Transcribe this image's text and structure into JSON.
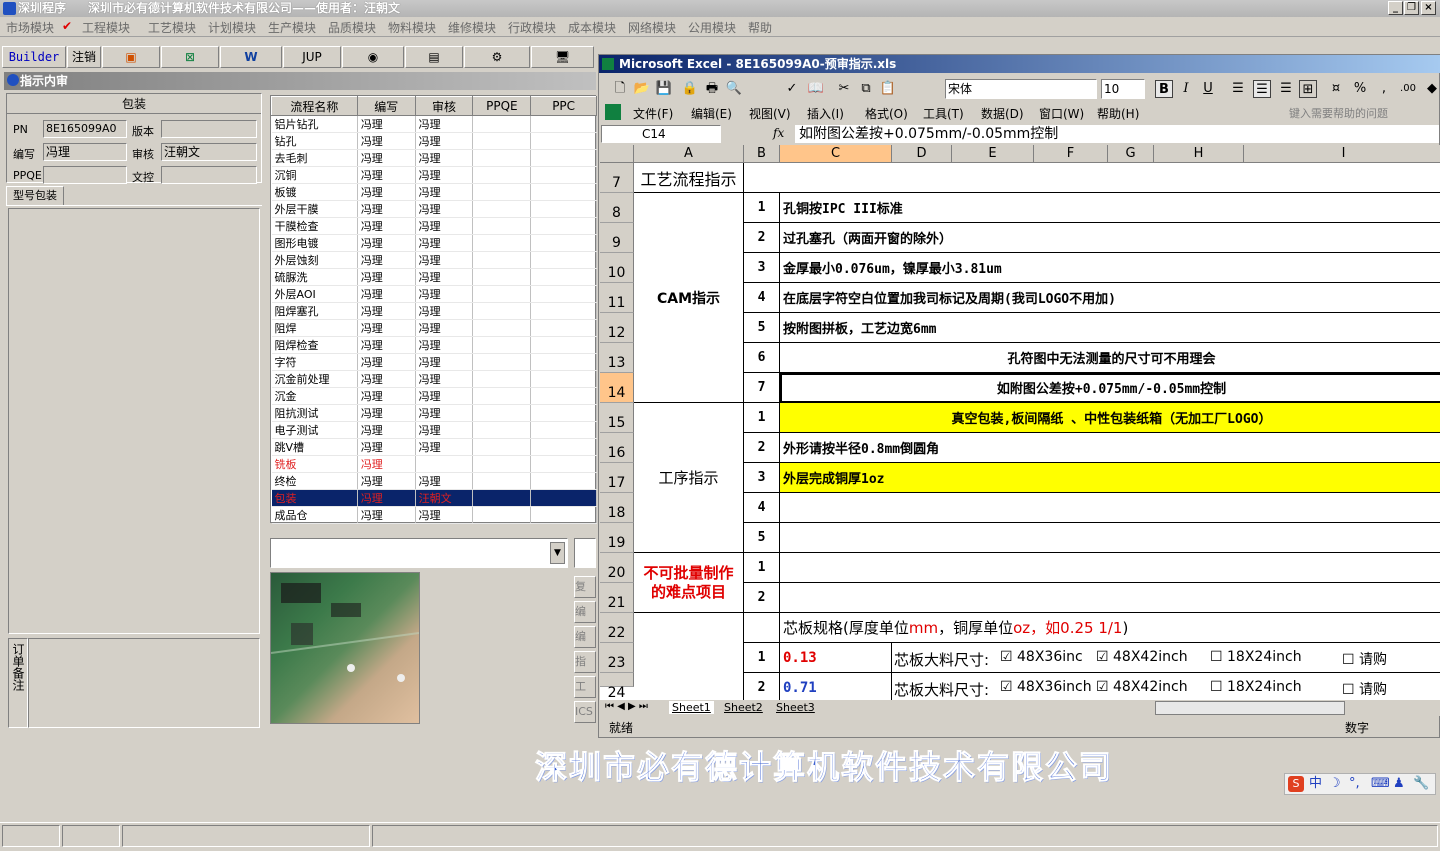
{
  "app": {
    "title": "深圳程序",
    "subtitle": "深圳市必有德计算机软件技术有限公司——使用者：汪朝文"
  },
  "menu": [
    "市场模块",
    "工程模块",
    "工艺模块",
    "计划模块",
    "生产模块",
    "品质模块",
    "物料模块",
    "维修模块",
    "行政模块",
    "成本模块",
    "网络模块",
    "公用模块",
    "帮助"
  ],
  "toolbar": {
    "builder": "Builder",
    "logout": "注销",
    "jup": "JUP"
  },
  "panel": {
    "title": "指示内审",
    "group": "包装",
    "pn_label": "PN",
    "pn_value": "8E165099A0",
    "version_label": "版本",
    "version_value": "",
    "writer_label": "编写",
    "writer_value": "冯理",
    "reviewer_label": "审核",
    "reviewer_value": "汪朝文",
    "ppqe_label": "PPQE",
    "ppqe_value": "",
    "doc_label": "文控",
    "doc_value": "",
    "tab": "型号包装",
    "order_note": "订单备注"
  },
  "process": {
    "headers": [
      "流程名称",
      "编写",
      "审核",
      "PPQE",
      "PPC"
    ],
    "rows": [
      [
        "铝片钻孔",
        "冯理",
        "冯理"
      ],
      [
        "钻孔",
        "冯理",
        "冯理"
      ],
      [
        "去毛刺",
        "冯理",
        "冯理"
      ],
      [
        "沉铜",
        "冯理",
        "冯理"
      ],
      [
        "板镀",
        "冯理",
        "冯理"
      ],
      [
        "外层干膜",
        "冯理",
        "冯理"
      ],
      [
        "干膜检查",
        "冯理",
        "冯理"
      ],
      [
        "图形电镀",
        "冯理",
        "冯理"
      ],
      [
        "外层蚀刻",
        "冯理",
        "冯理"
      ],
      [
        "硫脲洗",
        "冯理",
        "冯理"
      ],
      [
        "外层AOI",
        "冯理",
        "冯理"
      ],
      [
        "阻焊塞孔",
        "冯理",
        "冯理"
      ],
      [
        "阻焊",
        "冯理",
        "冯理"
      ],
      [
        "阻焊检查",
        "冯理",
        "冯理"
      ],
      [
        "字符",
        "冯理",
        "冯理"
      ],
      [
        "沉金前处理",
        "冯理",
        "冯理"
      ],
      [
        "沉金",
        "冯理",
        "冯理"
      ],
      [
        "阻抗测试",
        "冯理",
        "冯理"
      ],
      [
        "电子测试",
        "冯理",
        "冯理"
      ],
      [
        "跳V槽",
        "冯理",
        "冯理"
      ],
      [
        "铣板",
        "冯理",
        ""
      ],
      [
        "终检",
        "冯理",
        "冯理"
      ],
      [
        "包装",
        "冯理",
        "汪朝文"
      ],
      [
        "成品仓",
        "冯理",
        "冯理"
      ]
    ]
  },
  "side_buttons": [
    "复制",
    "编辑",
    "编辑",
    "指示",
    "工具",
    "ICS"
  ],
  "excel": {
    "title": "Microsoft Excel - 8E165099A0-预审指示.xls",
    "font": "宋体",
    "size": "10",
    "menu": [
      "文件(F)",
      "编辑(E)",
      "视图(V)",
      "插入(I)",
      "格式(O)",
      "工具(T)",
      "数据(D)",
      "窗口(W)",
      "帮助(H)"
    ],
    "help_box": "键入需要帮助的问题",
    "cell_ref": "C14",
    "formula": "如附图公差按+0.075mm/-0.05mm控制",
    "columns": [
      "A",
      "B",
      "C",
      "D",
      "E",
      "F",
      "G",
      "H",
      "I"
    ],
    "row_numbers": [
      "7",
      "8",
      "9",
      "10",
      "11",
      "12",
      "13",
      "14",
      "15",
      "16",
      "17",
      "18",
      "19",
      "20",
      "21",
      "22",
      "23",
      "24"
    ],
    "sec_process": "工艺流程指示",
    "sec_cam": "CAM指示",
    "sec_proc": "工序指示",
    "sec_diff": "不可批量制作的难点项目",
    "cam_items": [
      [
        "1",
        "孔铜按IPC III标准"
      ],
      [
        "2",
        "过孔塞孔（两面开窗的除外）"
      ],
      [
        "3",
        "金厚最小0.076um，镍厚最小3.81um"
      ],
      [
        "4",
        "在底层字符空白位置加我司标记及周期(我司LOGO不用加)"
      ],
      [
        "5",
        "按附图拼板，工艺边宽6mm"
      ],
      [
        "6",
        "孔符图中无法测量的尺寸可不用理会"
      ],
      [
        "7",
        "如附图公差按+0.075mm/-0.05mm控制"
      ]
    ],
    "proc_items": [
      [
        "1",
        "真空包装,板间隔纸 、中性包装纸箱（无加工厂LOGO）"
      ],
      [
        "2",
        "外形请按半径0.8mm倒圆角"
      ],
      [
        "3",
        "外层完成铜厚1oz"
      ],
      [
        "4",
        ""
      ],
      [
        "5",
        ""
      ]
    ],
    "diff_items": [
      "1",
      "2"
    ],
    "core_title_a": "芯板规格(厚度单位",
    "core_title_mm": "mm",
    "core_title_b": "，铜厚单位",
    "core_title_oz": "oz，如0.25 1/1",
    "core_title_c": ")",
    "core_rows": [
      {
        "n": "1",
        "thick": "0.13",
        "label": "芯板大料尺寸:",
        "o1": "48X36inc",
        "o2": "48X42inch",
        "o3": "18X24inch",
        "o4": "请购"
      },
      {
        "n": "2",
        "thick": "0.71",
        "label": "芯板大料尺寸:",
        "o1": "48X36inch",
        "o2": "48X42inch",
        "o3": "18X24inch",
        "o4": "请购"
      }
    ],
    "sheets": [
      "Sheet1",
      "Sheet2",
      "Sheet3"
    ],
    "status": "就绪",
    "status_right": "数字"
  },
  "banner": "深圳市必有德计算机软件技术有限公司",
  "ime": "中"
}
